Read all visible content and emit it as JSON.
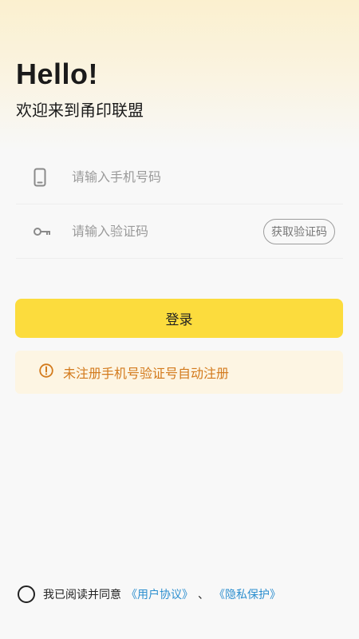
{
  "header": {
    "greeting": "Hello!",
    "welcome": "欢迎来到甬印联盟"
  },
  "form": {
    "phone_placeholder": "请输入手机号码",
    "code_placeholder": "请输入验证码",
    "get_code_label": "获取验证码",
    "login_label": "登录"
  },
  "notice": {
    "text": "未注册手机号验证号自动注册"
  },
  "agreement": {
    "prefix": "我已阅读并同意",
    "user_agreement": "《用户协议》",
    "separator": "、",
    "privacy": "《隐私保护》"
  },
  "colors": {
    "primary_button": "#fcdc3d",
    "notice_text": "#d37a1c",
    "link": "#2d8fcf"
  }
}
